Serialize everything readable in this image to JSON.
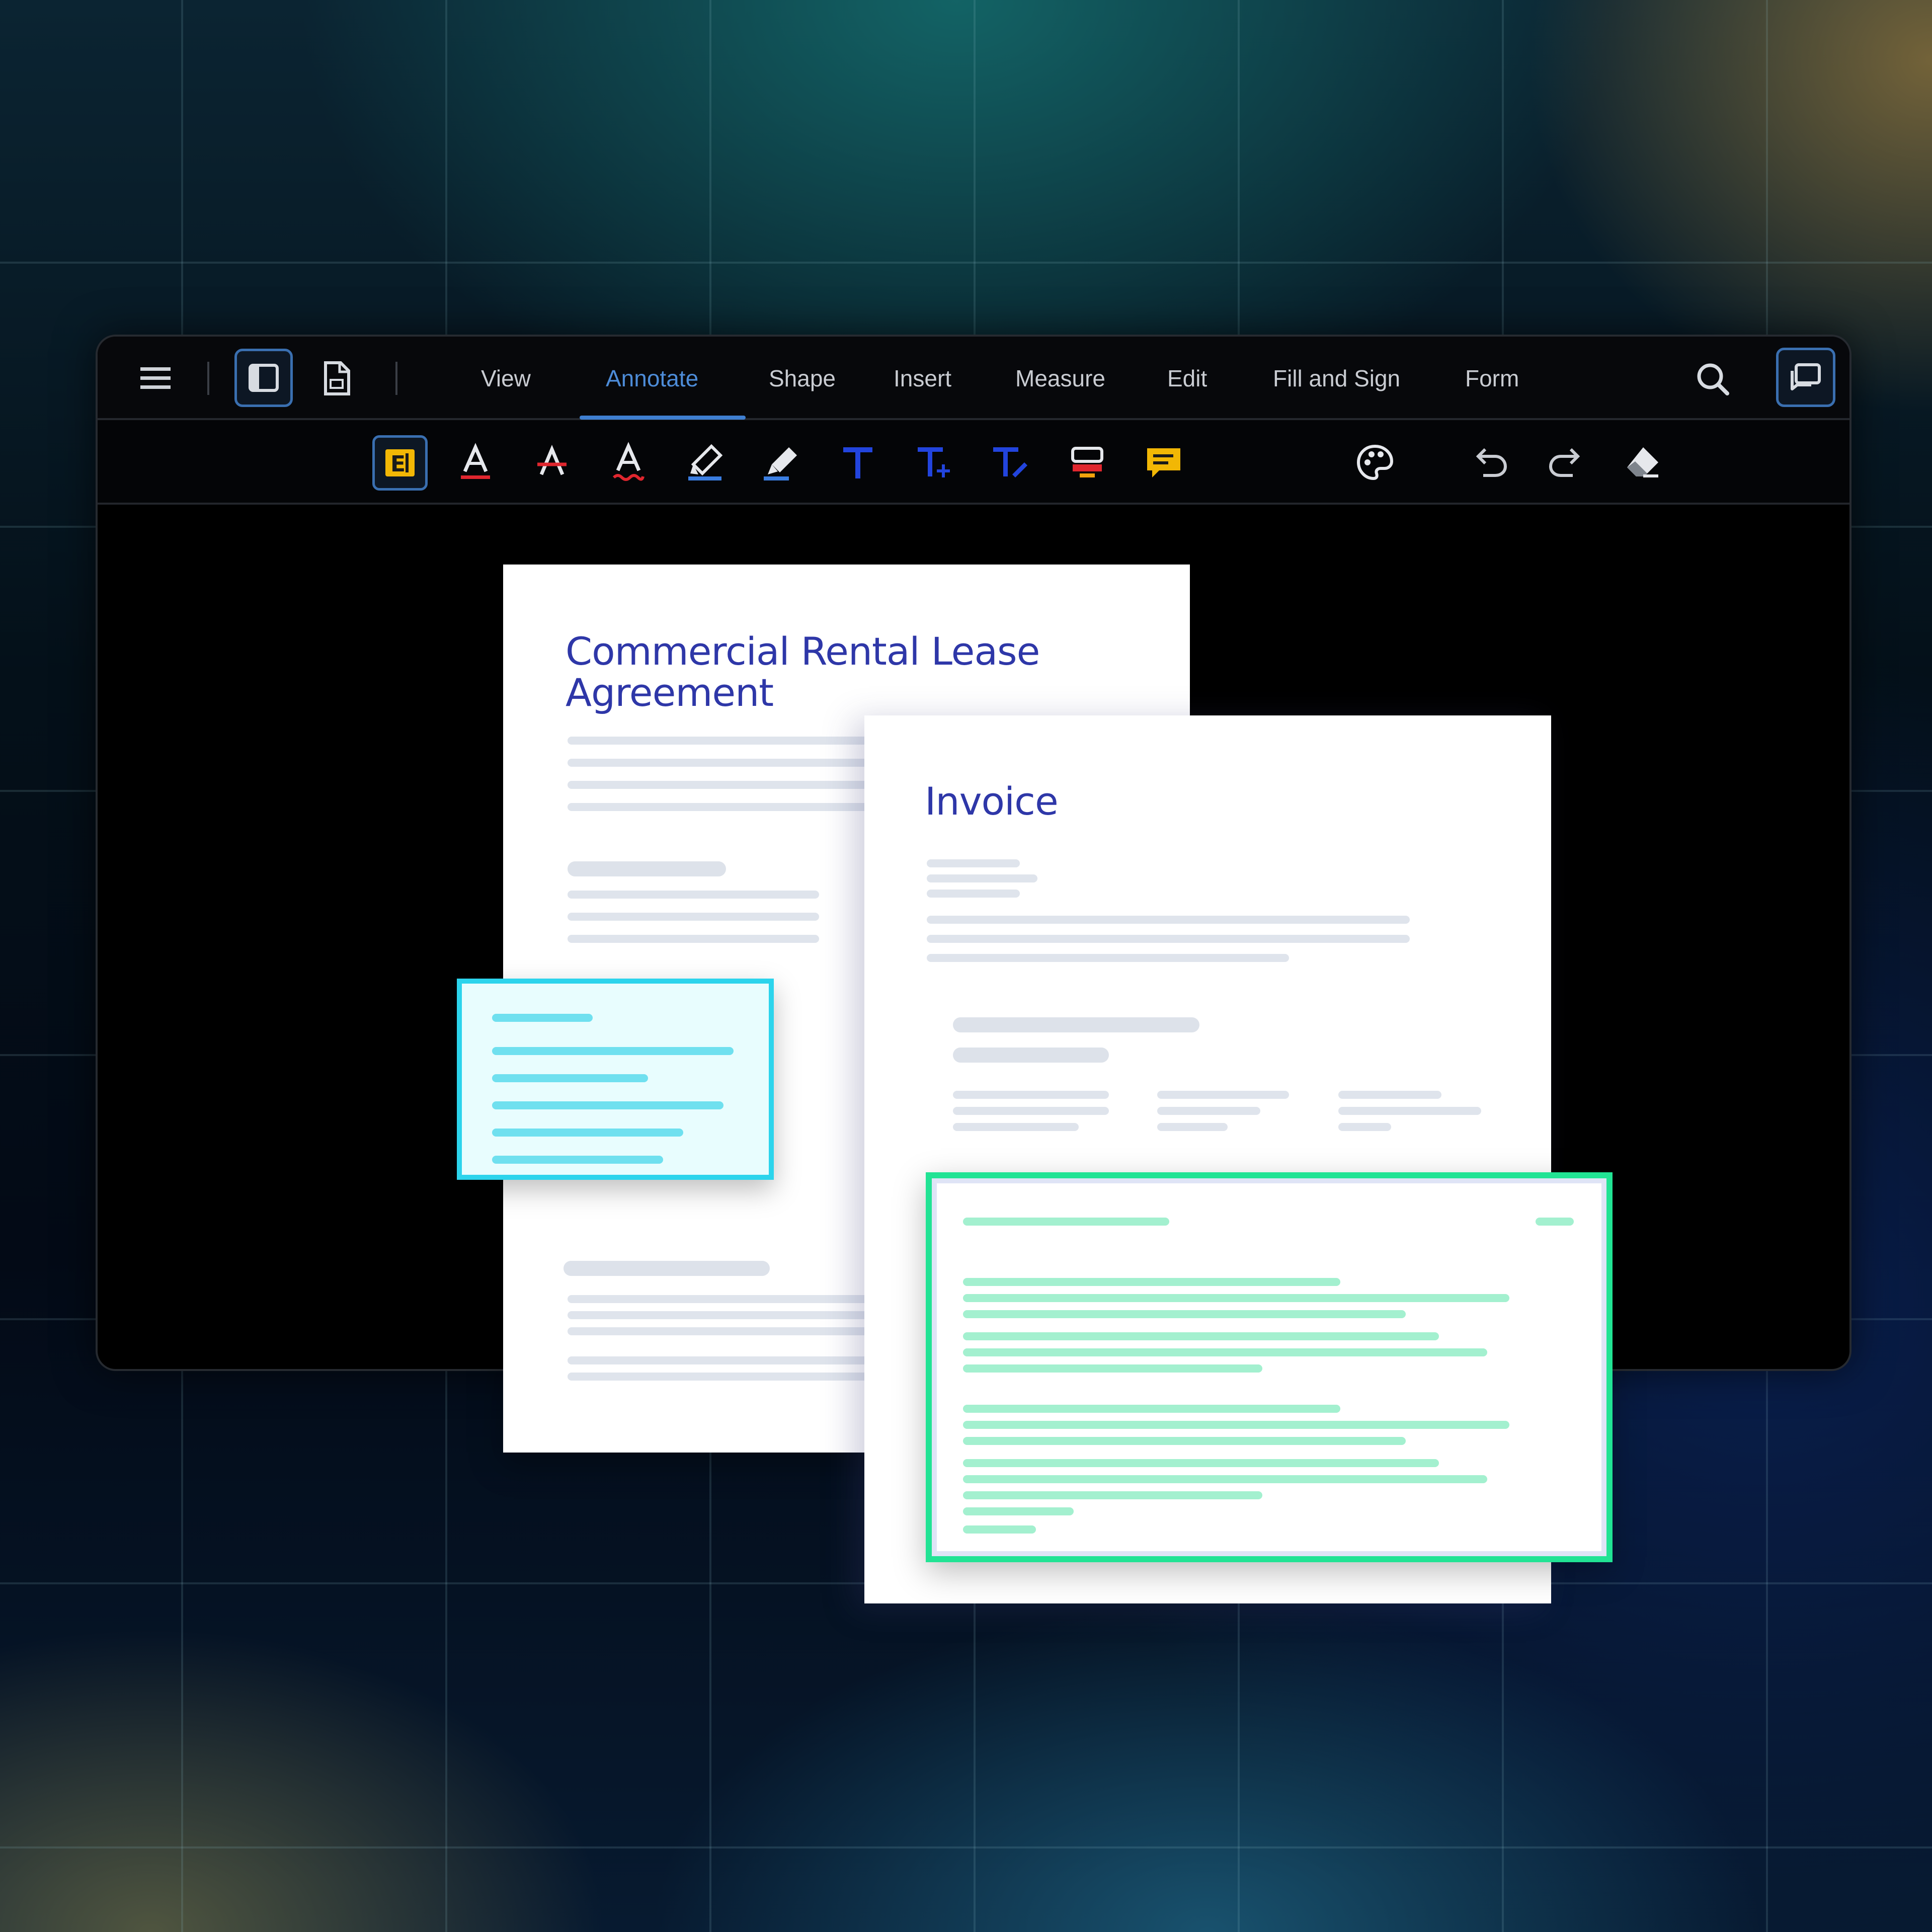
{
  "colors": {
    "accent": "#4d8cd8",
    "doc_title": "#2e37a8",
    "highlight_cyan": "#2cd4ec",
    "highlight_green": "#21e394"
  },
  "topbar": {
    "icons": [
      "menu-icon",
      "sidebar-panel-icon",
      "document-icon",
      "search-icon",
      "comment-panel-icon"
    ],
    "tabs": [
      {
        "label": "View",
        "active": false
      },
      {
        "label": "Annotate",
        "active": true
      },
      {
        "label": "Shape",
        "active": false
      },
      {
        "label": "Insert",
        "active": false
      },
      {
        "label": "Measure",
        "active": false
      },
      {
        "label": "Edit",
        "active": false
      },
      {
        "label": "Fill and Sign",
        "active": false
      },
      {
        "label": "Form",
        "active": false
      }
    ]
  },
  "toolbar": {
    "tools": [
      "text-select-icon",
      "text-underline-icon",
      "text-strikeout-icon",
      "text-squiggly-icon",
      "highlighter-icon",
      "free-highlight-icon",
      "free-text-icon",
      "text-callout-icon",
      "text-typewriter-icon",
      "stamp-icon",
      "sticky-note-icon",
      "color-palette-icon",
      "undo-icon",
      "redo-icon",
      "eraser-icon"
    ]
  },
  "documents": {
    "lease": {
      "title_line1": "Commercial Rental Lease",
      "title_line2": "Agreement"
    },
    "invoice": {
      "title": "Invoice"
    }
  }
}
